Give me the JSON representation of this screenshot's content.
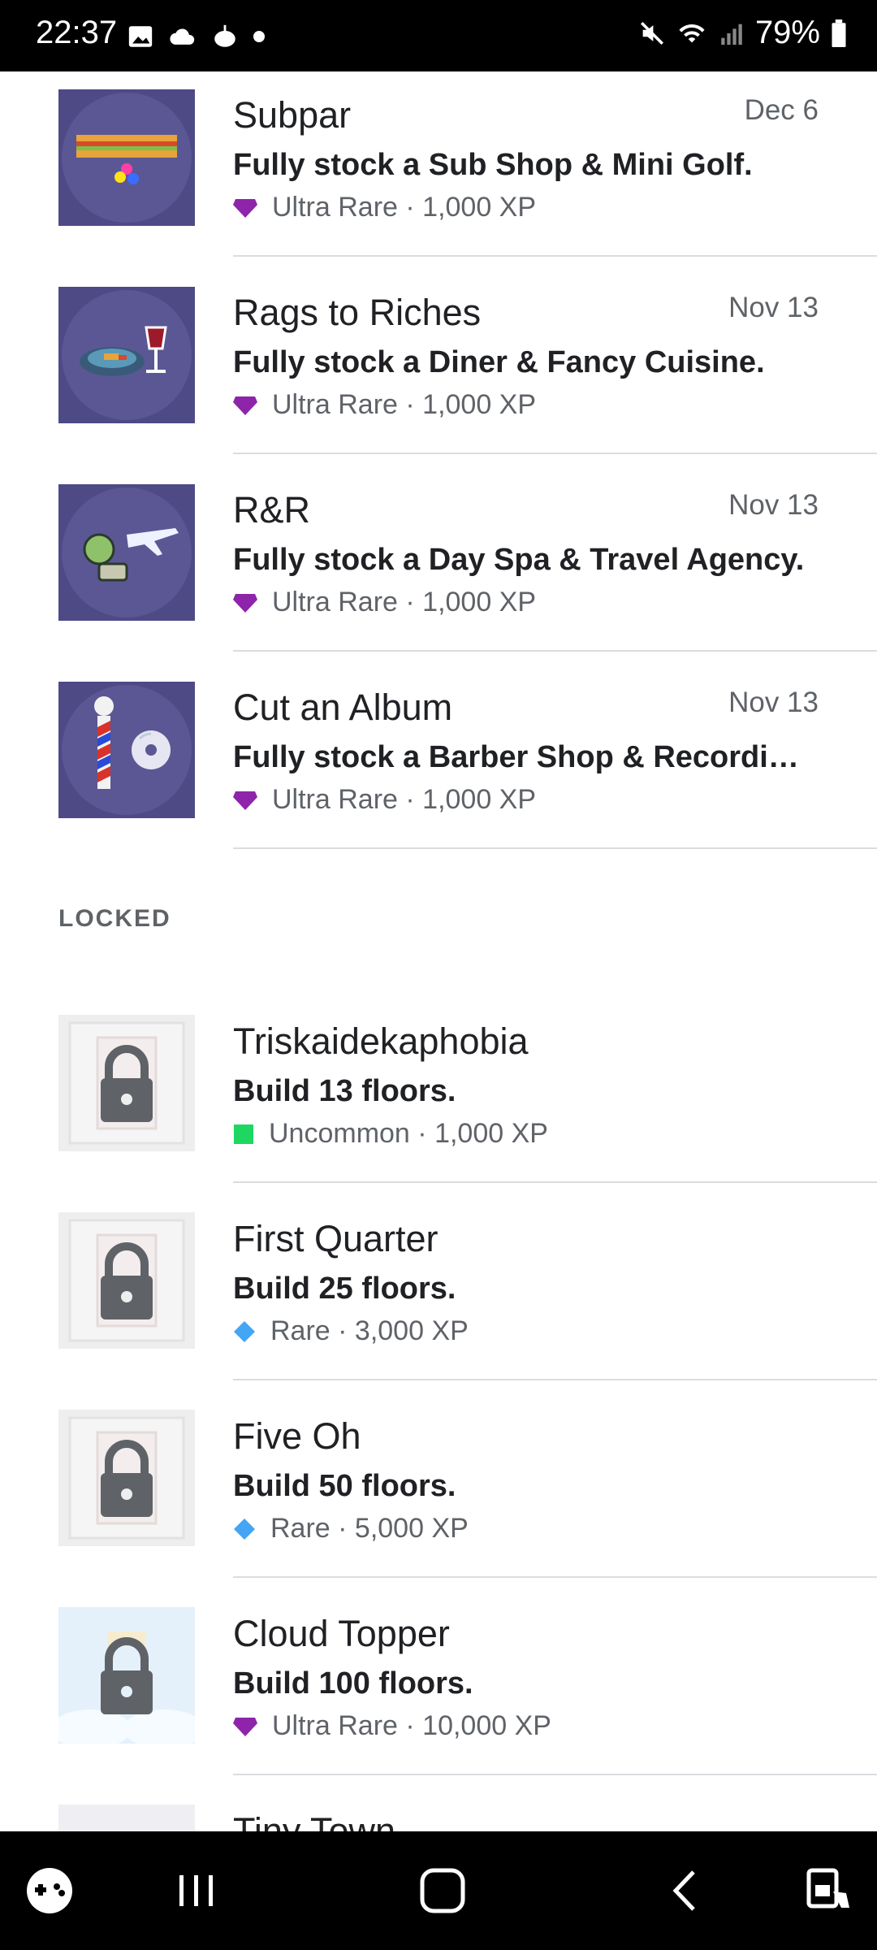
{
  "status_bar": {
    "time": "22:37",
    "battery": "79%"
  },
  "achievements_unlocked": [
    {
      "title": "Subpar",
      "date": "Dec 6",
      "description": "Fully stock a Sub Shop & Mini Golf.",
      "rarity": "Ultra Rare",
      "xp": "1,000 XP",
      "rarity_color": "#8e24aa",
      "icon": "sub-sandwich-icon"
    },
    {
      "title": "Rags to Riches",
      "date": "Nov 13",
      "description": "Fully stock a Diner & Fancy Cuisine.",
      "rarity": "Ultra Rare",
      "xp": "1,000 XP",
      "rarity_color": "#8e24aa",
      "icon": "plate-and-wine-icon"
    },
    {
      "title": "R&R",
      "date": "Nov 13",
      "description": "Fully stock a Day Spa & Travel Agency.",
      "rarity": "Ultra Rare",
      "xp": "1,000 XP",
      "rarity_color": "#8e24aa",
      "icon": "spa-and-plane-icon"
    },
    {
      "title": "Cut an Album",
      "date": "Nov 13",
      "description": "Fully stock a Barber Shop & Recordi…",
      "rarity": "Ultra Rare",
      "xp": "1,000 XP",
      "rarity_color": "#8e24aa",
      "icon": "barber-pole-and-cd-icon"
    }
  ],
  "locked_section": {
    "label": "LOCKED"
  },
  "achievements_locked": [
    {
      "title": "Triskaidekaphobia",
      "description": "Build 13 floors.",
      "rarity": "Uncommon",
      "xp": "1,000 XP",
      "rarity_color": "#1ed760",
      "icon": "lock-icon"
    },
    {
      "title": "First Quarter",
      "description": "Build 25 floors.",
      "rarity": "Rare",
      "xp": "3,000 XP",
      "rarity_color": "#42a5f5",
      "icon": "lock-icon"
    },
    {
      "title": "Five Oh",
      "description": "Build 50 floors.",
      "rarity": "Rare",
      "xp": "5,000 XP",
      "rarity_color": "#42a5f5",
      "icon": "lock-icon"
    },
    {
      "title": "Cloud Topper",
      "description": "Build 100 floors.",
      "rarity": "Ultra Rare",
      "xp": "10,000 XP",
      "rarity_color": "#8e24aa",
      "icon": "lock-icon"
    },
    {
      "title": "Tiny Town",
      "icon": "lock-icon"
    }
  ],
  "colors": {
    "badge_bg": "#5b5794",
    "text_primary": "#202124",
    "text_secondary": "#5f6368",
    "divider": "#dadce0"
  }
}
